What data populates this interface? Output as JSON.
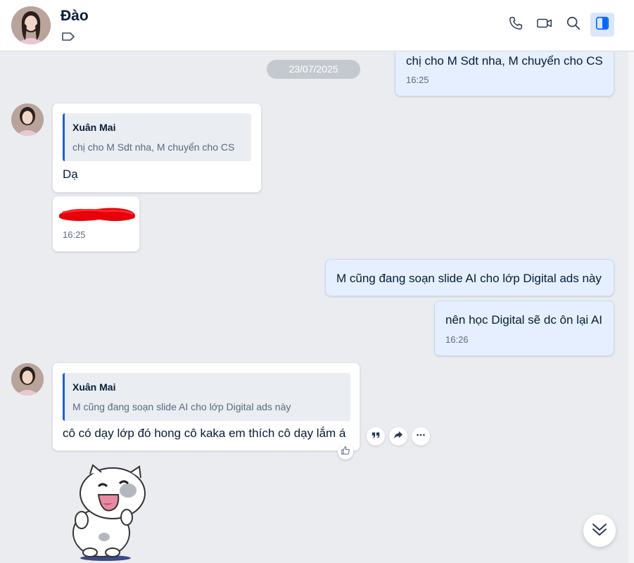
{
  "header": {
    "contact_name": "Đào",
    "icons": [
      "tag-icon",
      "phone-icon",
      "video-call-icon",
      "search-icon",
      "sidebar-toggle-icon"
    ]
  },
  "conversation": {
    "date_divider": "23/07/2025",
    "messages": [
      {
        "sender": "me",
        "text": "chị cho M Sdt nha, M chuyển cho CS",
        "time": "16:25"
      },
      {
        "sender": "them",
        "quote_name": "Xuân Mai",
        "quote_text": "chị cho M Sdt nha, M chuyển cho CS",
        "text": "Dạ"
      },
      {
        "sender": "them",
        "type": "redacted-image",
        "time": "16:25"
      },
      {
        "sender": "me",
        "text": "M cũng đang soạn slide AI cho lớp Digital ads này"
      },
      {
        "sender": "me",
        "text": "nên học Digital sẽ dc ôn lại AI",
        "time": "16:26"
      },
      {
        "sender": "them",
        "quote_name": "Xuân Mai",
        "quote_text": "M cũng đang soạn slide AI cho lớp Digital ads này",
        "text": "cô có dạy lớp đó hong cô kaka em thích cô dạy lắm á"
      },
      {
        "sender": "them",
        "type": "sticker",
        "icon": "cat-sticker-icon"
      }
    ]
  },
  "colors": {
    "accent": "#1b5fd6",
    "my_bubble": "#e5efff",
    "background": "#ebecf0"
  }
}
